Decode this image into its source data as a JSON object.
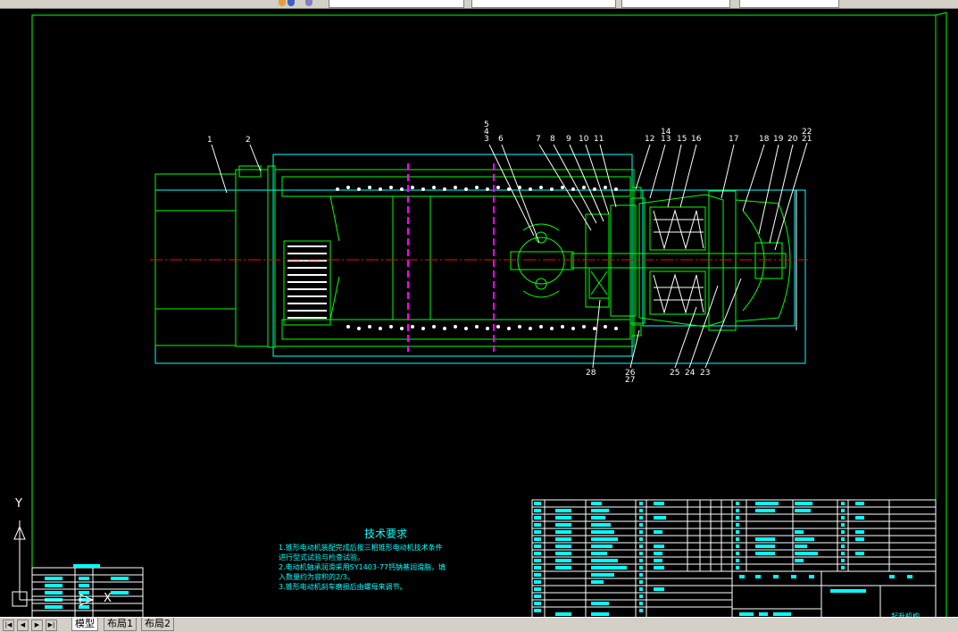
{
  "tech_requirements": {
    "title": "技术要求",
    "lines": [
      "1.锥形电动机装配完成后按三相锥形电动机技术条件",
      "   进行型式试验与检查试验。",
      "2.电动机轴承润滑采用SY1403-77钙钠基润滑脂，填",
      "   入数量约为容积的2/3。",
      "3.锥形电动机刹车磨损后由螺母来调节。"
    ]
  },
  "part_labels_top": [
    "1",
    "2",
    "5",
    "4",
    "3",
    "6",
    "7",
    "8",
    "9",
    "10",
    "11",
    "12",
    "14",
    "13",
    "15",
    "16",
    "17",
    "18",
    "19",
    "20",
    "22",
    "21"
  ],
  "part_labels_bottom": [
    "28",
    "26",
    "27",
    "25",
    "24",
    "23"
  ],
  "ucs": {
    "y_label": "Y",
    "x_label": "X"
  },
  "layout_tabs": [
    "模型",
    "布局1",
    "布局2"
  ],
  "nav_buttons": [
    "|◀",
    "◀",
    "▶",
    "▶|"
  ],
  "title_block_label": "起升机构",
  "colors": {
    "background": "#000000",
    "frame": "#00ff00",
    "drawing": "#00ff00",
    "outline": "#00ffff",
    "dimension": "#ffffff",
    "centerline": "#ff0000",
    "section": "#ff00ff",
    "table_text": "#00ffff"
  }
}
